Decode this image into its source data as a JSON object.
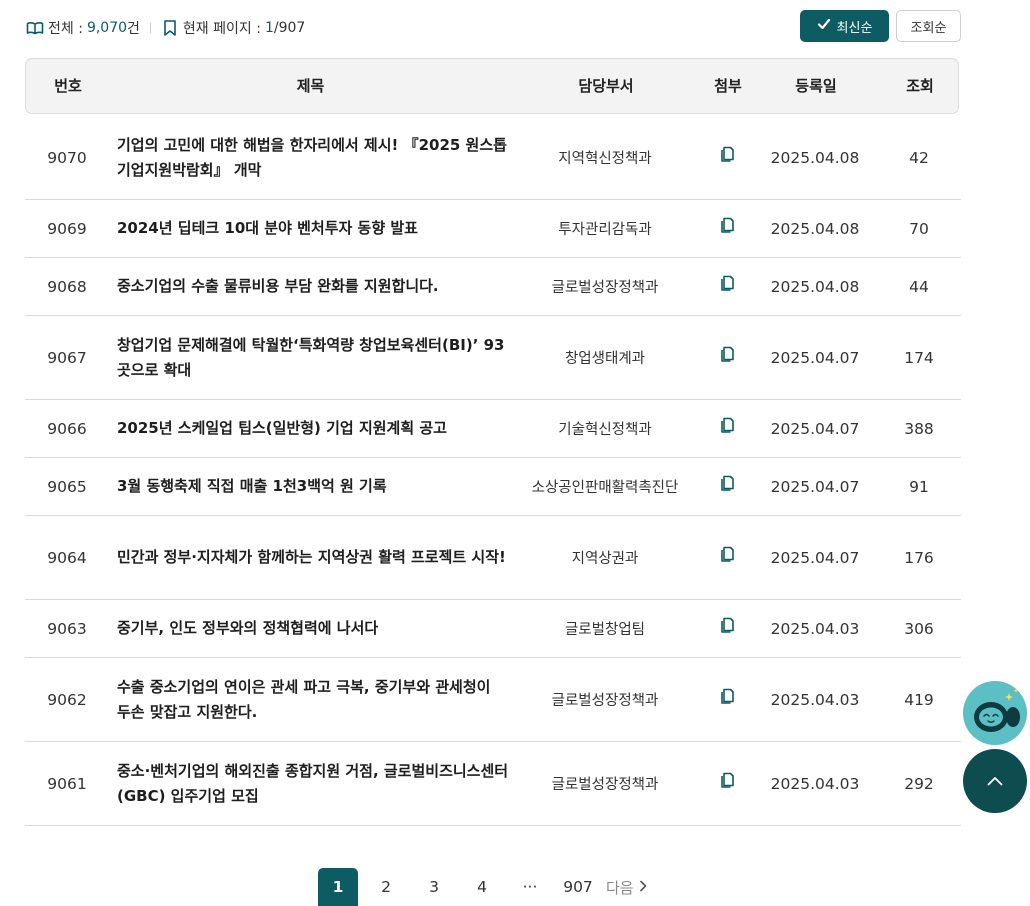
{
  "summary": {
    "total_label": "전체 :",
    "total_value": "9,070",
    "total_unit": "건",
    "page_label": "현재 페이지 :",
    "page_current": "1",
    "page_total": "/907"
  },
  "sort": {
    "latest_label": "최신순",
    "views_label": "조회순"
  },
  "table": {
    "headers": {
      "no": "번호",
      "title": "제목",
      "dept": "담당부서",
      "attachment": "첨부",
      "date": "등록일",
      "views": "조회"
    },
    "rows": [
      {
        "no": "9070",
        "title": "기업의 고민에 대한 해법을 한자리에서 제시! 『2025 원스톱기업지원박람회』 개막",
        "dept": "지역혁신정책과",
        "date": "2025.04.08",
        "views": "42"
      },
      {
        "no": "9069",
        "title": "2024년 딥테크 10대 분야 벤처투자 동향 발표",
        "dept": "투자관리감독과",
        "date": "2025.04.08",
        "views": "70"
      },
      {
        "no": "9068",
        "title": "중소기업의 수출 물류비용 부담 완화를 지원합니다.",
        "dept": "글로벌성장정책과",
        "date": "2025.04.08",
        "views": "44"
      },
      {
        "no": "9067",
        "title": "창업기업 문제해결에 탁월한‘특화역량 창업보육센터(BI)’ 93곳으로 확대",
        "dept": "창업생태계과",
        "date": "2025.04.07",
        "views": "174"
      },
      {
        "no": "9066",
        "title": "2025년 스케일업 팁스(일반형) 기업 지원계획 공고",
        "dept": "기술혁신정책과",
        "date": "2025.04.07",
        "views": "388"
      },
      {
        "no": "9065",
        "title": "3월 동행축제 직접 매출 1천3백억 원 기록",
        "dept": "소상공인판매활력촉진단",
        "date": "2025.04.07",
        "views": "91"
      },
      {
        "no": "9064",
        "title": "민간과 정부·지자체가 함께하는 지역상권 활력 프로젝트 시작!",
        "dept": "지역상권과",
        "date": "2025.04.07",
        "views": "176"
      },
      {
        "no": "9063",
        "title": "중기부, 인도 정부와의 정책협력에 나서다",
        "dept": "글로벌창업팀",
        "date": "2025.04.03",
        "views": "306"
      },
      {
        "no": "9062",
        "title": "수출 중소기업의 연이은 관세 파고 극복, 중기부와 관세청이 두손 맞잡고 지원한다.",
        "dept": "글로벌성장정책과",
        "date": "2025.04.03",
        "views": "419"
      },
      {
        "no": "9061",
        "title": "중소·벤처기업의 해외진출 종합지원 거점, 글로벌비즈니스센터(GBC) 입주기업 모집",
        "dept": "글로벌성장정책과",
        "date": "2025.04.03",
        "views": "292"
      }
    ]
  },
  "pagination": {
    "pages": [
      "1",
      "2",
      "3",
      "4"
    ],
    "ellipsis": "···",
    "last": "907",
    "next_label": "다음"
  },
  "colors": {
    "accent": "#0d5c63",
    "fab_dark": "#0d4d4f",
    "robot_bg": "#5bbfc5"
  },
  "icons": {
    "total": "book-open-icon",
    "page": "bookmark-icon",
    "sort_active": "check-icon",
    "attachment": "file-attachment-icon",
    "next": "chevron-right-icon",
    "scroll_top": "chevron-up-icon",
    "chatbot": "robot-icon"
  }
}
